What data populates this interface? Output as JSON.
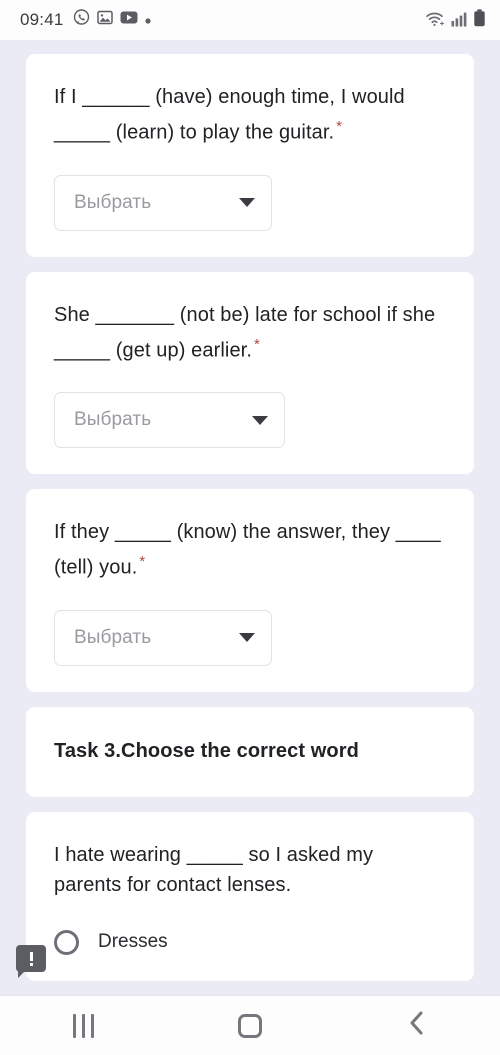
{
  "status_bar": {
    "time": "09:41",
    "left_icons": [
      "whatsapp-icon",
      "gallery-icon",
      "youtube-icon",
      "dot-icon"
    ],
    "right_icons": [
      "wifi-icon",
      "cellular-signal-icon",
      "battery-icon"
    ]
  },
  "questions": [
    {
      "text": "If I ______ (have) enough time, I would _____ (learn) to play the guitar.",
      "required_marker": "*",
      "dropdown": {
        "placeholder": "Выбрать",
        "width": "w1"
      }
    },
    {
      "text": "She _______ (not be) late for school if she _____ (get up) earlier.",
      "required_marker": "*",
      "dropdown": {
        "placeholder": "Выбрать",
        "width": "w2"
      }
    },
    {
      "text": "If they _____ (know) the answer, they ____ (tell) you.",
      "required_marker": "*",
      "dropdown": {
        "placeholder": "Выбрать",
        "width": "w1"
      }
    }
  ],
  "section": {
    "title": "Task 3.Choose the correct word"
  },
  "choice_question": {
    "text": "I hate wearing _____ so I asked my parents for contact lenses.",
    "options": [
      {
        "label": "Dresses",
        "selected": false
      }
    ]
  },
  "feedback_badge": {
    "icon": "chat-alert-icon",
    "symbol": "!"
  },
  "nav_bar": {
    "buttons": [
      {
        "name": "recents-button",
        "icon": "recents-icon"
      },
      {
        "name": "home-button",
        "icon": "home-icon"
      },
      {
        "name": "back-button",
        "icon": "back-chevron-icon"
      }
    ]
  },
  "colors": {
    "page_background": "#ebebf5",
    "card_background": "#ffffff",
    "text": "#222226",
    "required_asterisk": "#b04a44",
    "placeholder": "#9a9aa0",
    "badge": "#5c5c63"
  }
}
